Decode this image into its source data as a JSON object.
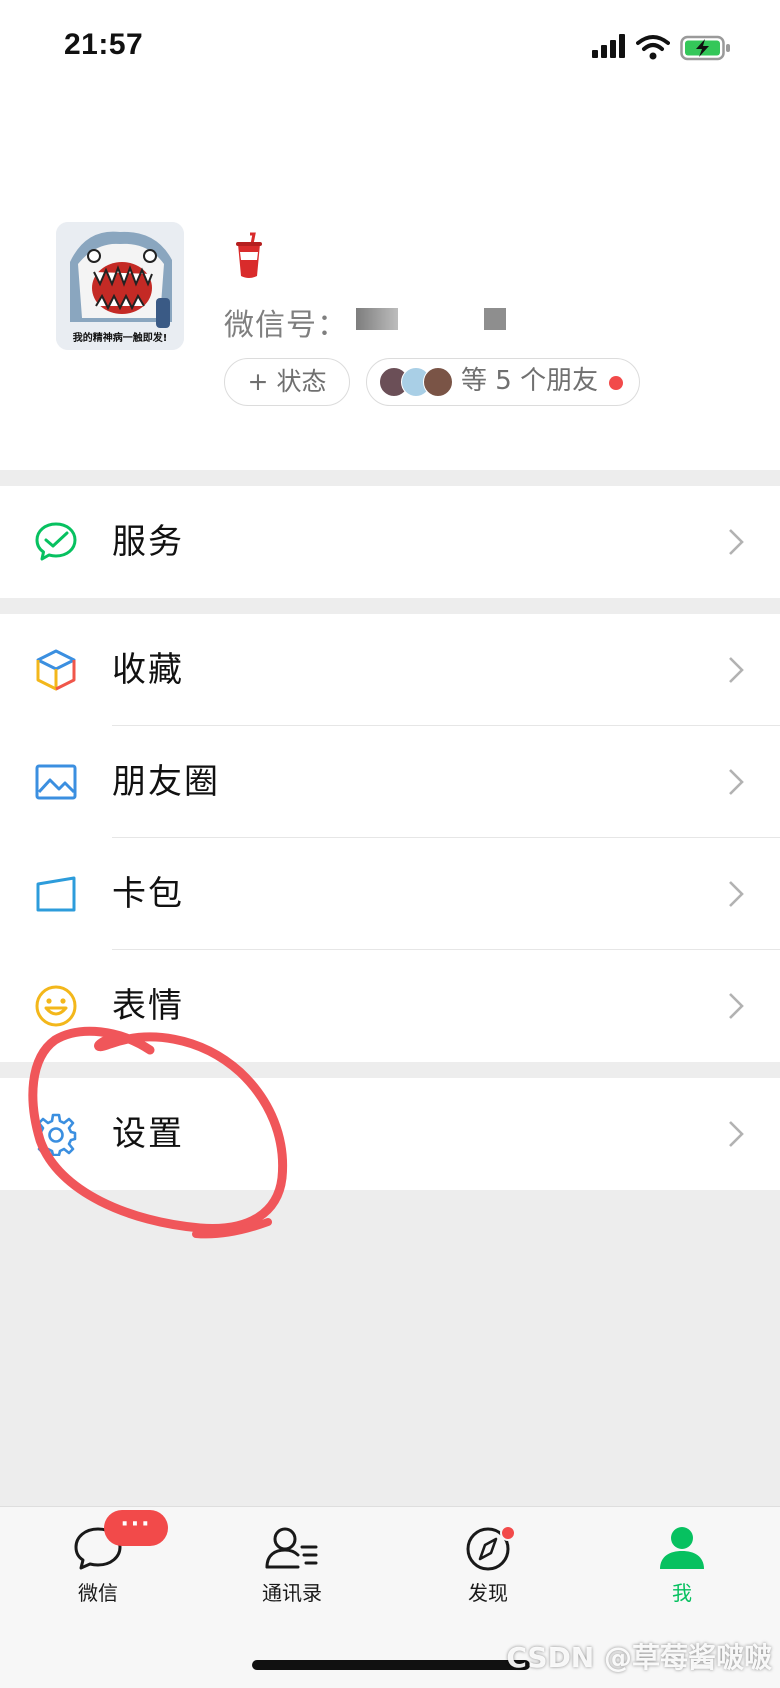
{
  "status_bar": {
    "time": "21:57",
    "icons": [
      "signal-icon",
      "wifi-icon",
      "battery-charging-icon"
    ]
  },
  "profile": {
    "nickname_icon": "drink-cup-icon",
    "avatar_caption": "我的精神病一触即发!",
    "wechat_id_label": "微信号：",
    "status_button": "+ 状态",
    "friends_text": "等 5 个朋友"
  },
  "menu": {
    "services": "服务",
    "favorites": "收藏",
    "moments": "朋友圈",
    "cards": "卡包",
    "stickers": "表情",
    "settings": "设置"
  },
  "tabs": {
    "chats": "微信",
    "contacts": "通讯录",
    "discover": "发现",
    "me": "我",
    "chats_badge": "···"
  },
  "colors": {
    "accent_green": "#07c160",
    "badge_red": "#f24a4a",
    "annotation_red": "#f0565a"
  },
  "watermark": "CSDN @草莓酱啵啵"
}
